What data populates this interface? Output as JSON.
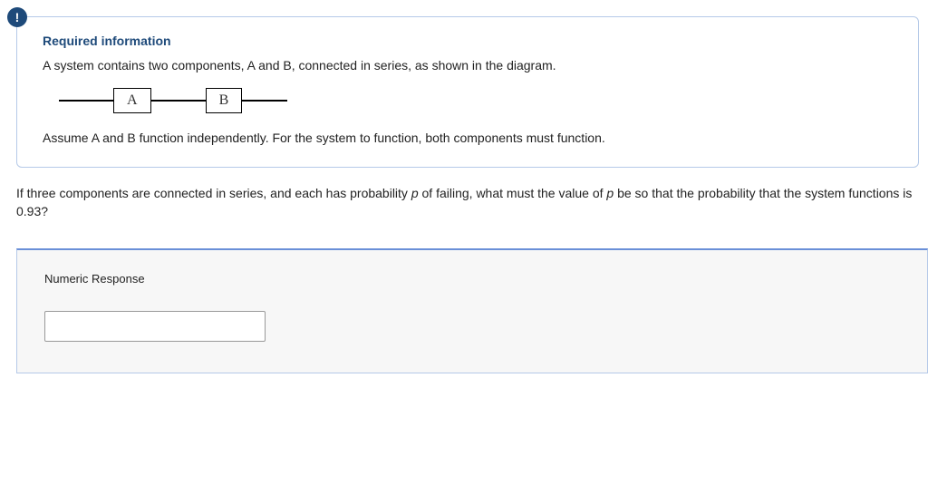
{
  "badge": "!",
  "info": {
    "title": "Required information",
    "line1": "A system contains two components, A and B, connected in series, as shown in the diagram.",
    "compA": "A",
    "compB": "B",
    "line2": "Assume A and B function independently. For the system to function, both components must function."
  },
  "question": {
    "prefix": "If three components are connected in series, and each has probability ",
    "p1": "p",
    "mid": " of failing, what must the value of ",
    "p2": "p",
    "suffix": " be so that the probability that the system functions is 0.93?"
  },
  "response": {
    "label": "Numeric Response",
    "value": ""
  }
}
